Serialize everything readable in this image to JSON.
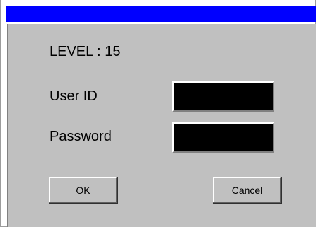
{
  "dialog": {
    "title_bar_color": "#0000ff",
    "background_color": "#c0c0c0"
  },
  "level": {
    "label": "LEVEL : 15"
  },
  "user_id": {
    "label": "User ID",
    "value": ""
  },
  "password": {
    "label": "Password",
    "value": ""
  },
  "buttons": {
    "ok_label": "OK",
    "cancel_label": "Cancel"
  }
}
